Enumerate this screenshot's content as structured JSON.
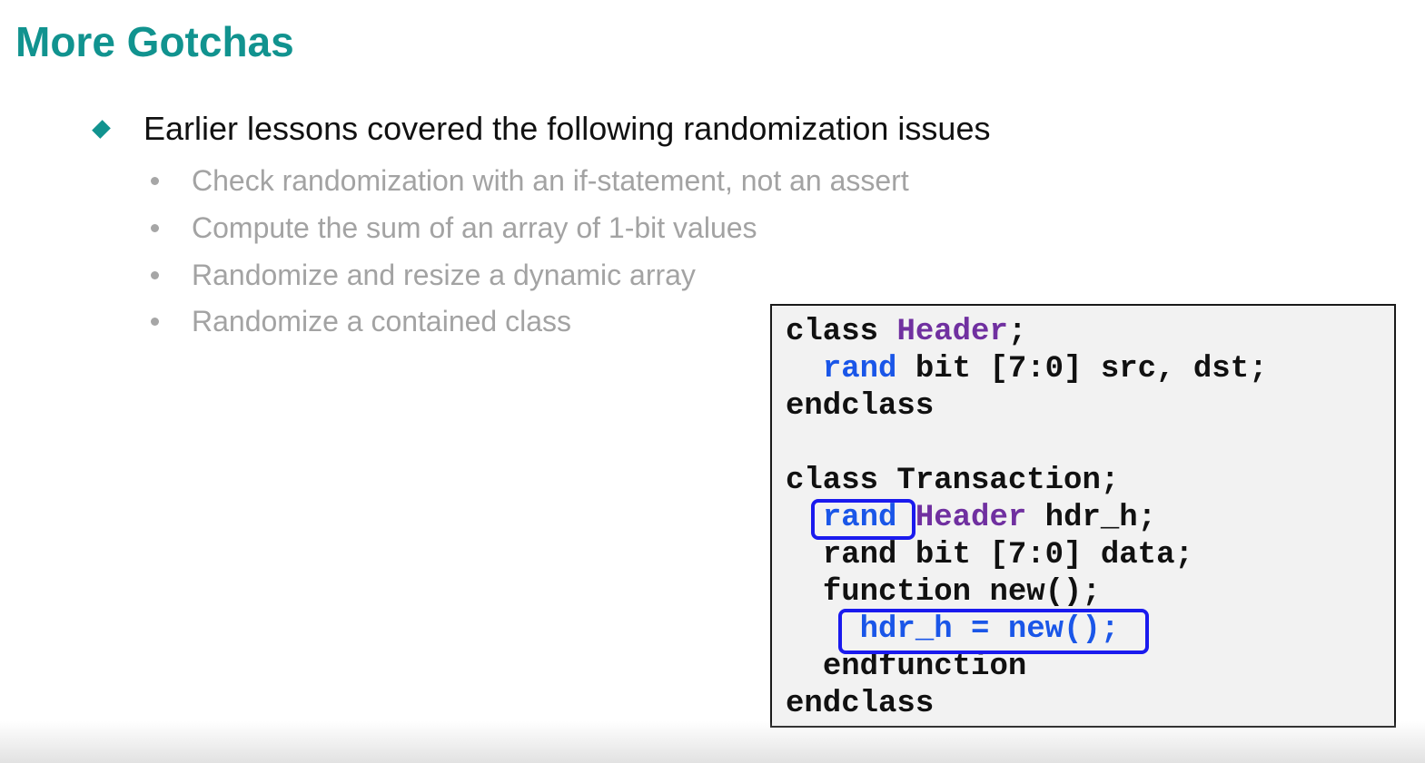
{
  "slide": {
    "title": "More Gotchas",
    "main_bullet": "Earlier lessons covered the following randomization issues",
    "sub_bullets": [
      "Check randomization with an if-statement, not an assert",
      "Compute the sum of an array of 1-bit values",
      "Randomize and resize a dynamic array",
      "Randomize a contained class"
    ]
  },
  "code": {
    "line1": {
      "kw": "class",
      "type": "Header",
      "rest": ";"
    },
    "line2": {
      "kw": "rand",
      "rest": " bit [7:0] src, dst;"
    },
    "line3": "endclass",
    "line5": "class Transaction;",
    "line6": {
      "kw": "rand",
      "type": "Header",
      "rest": " hdr_h;"
    },
    "line7": "rand bit [7:0] data;",
    "line8": "function new();",
    "line9": "hdr_h = new();",
    "line10": "endfunction",
    "line11": "endclass"
  },
  "colors": {
    "title": "#11938f",
    "keyword_blue": "#1a56e8",
    "type_purple": "#7030a0",
    "highlight_box": "#1a1aee",
    "sub_text": "#a3a3a3"
  },
  "icons": {
    "main_bullet": "diamond-bullet-icon",
    "sub_bullet": "dot-bullet-icon"
  }
}
